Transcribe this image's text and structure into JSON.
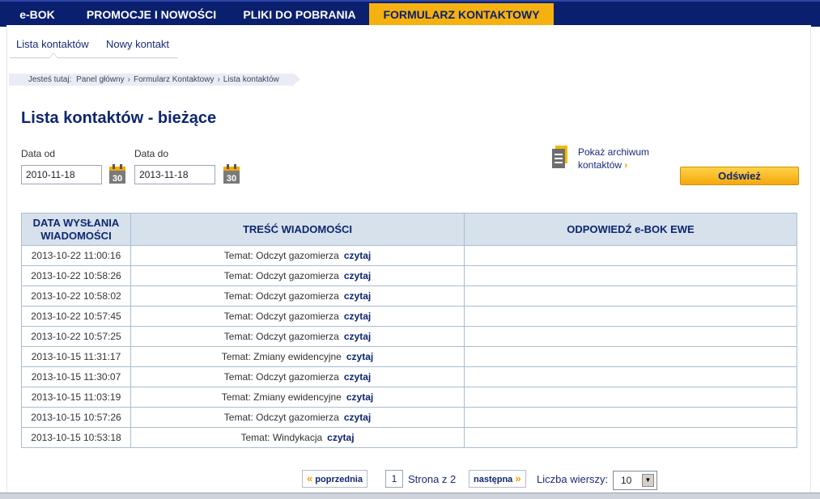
{
  "topnav": {
    "items": [
      {
        "label": "e-BOK"
      },
      {
        "label": "PROMOCJE I NOWOŚCI"
      },
      {
        "label": "PLIKI DO POBRANIA"
      },
      {
        "label": "FORMULARZ KONTAKTOWY",
        "active": true
      }
    ]
  },
  "subtabs": {
    "list": "Lista kontaktów",
    "new": "Nowy kontakt"
  },
  "breadcrumb": {
    "prefix": "Jesteś tutaj:",
    "items": [
      "Panel główny",
      "Formularz Kontaktowy",
      "Lista kontaktów"
    ]
  },
  "page_title": "Lista kontaktów - bieżące",
  "filters": {
    "date_from_label": "Data od",
    "date_from_value": "2010-11-18",
    "date_to_label": "Data do",
    "date_to_value": "2013-11-18",
    "calendar_day": "30"
  },
  "archive": {
    "line1": "Pokaż archiwum",
    "line2": "kontaktów",
    "chevron": "›"
  },
  "refresh_label": "Odśwież",
  "table": {
    "headers": [
      "DATA WYSŁANIA WIADOMOŚCI",
      "TREŚĆ WIADOMOŚCI",
      "ODPOWIEDŹ e-BOK EWE"
    ],
    "read_label": "czytaj",
    "rows": [
      {
        "date": "2013-10-22 11:00:16",
        "subject": "Temat: Odczyt gazomierza",
        "reply": ""
      },
      {
        "date": "2013-10-22 10:58:26",
        "subject": "Temat: Odczyt gazomierza",
        "reply": ""
      },
      {
        "date": "2013-10-22 10:58:02",
        "subject": "Temat: Odczyt gazomierza",
        "reply": ""
      },
      {
        "date": "2013-10-22 10:57:45",
        "subject": "Temat: Odczyt gazomierza",
        "reply": ""
      },
      {
        "date": "2013-10-22 10:57:25",
        "subject": "Temat: Odczyt gazomierza",
        "reply": ""
      },
      {
        "date": "2013-10-15 11:31:17",
        "subject": "Temat: Zmiany ewidencyjne",
        "reply": ""
      },
      {
        "date": "2013-10-15 11:30:07",
        "subject": "Temat: Odczyt gazomierza",
        "reply": ""
      },
      {
        "date": "2013-10-15 11:03:19",
        "subject": "Temat: Zmiany ewidencyjne",
        "reply": ""
      },
      {
        "date": "2013-10-15 10:57:26",
        "subject": "Temat: Odczyt gazomierza",
        "reply": ""
      },
      {
        "date": "2013-10-15 10:53:18",
        "subject": "Temat: Windykacja",
        "reply": ""
      }
    ]
  },
  "pager": {
    "prev_label": "poprzednia",
    "current_page": "1",
    "of_label": "Strona z 2",
    "next_label": "następna",
    "rows_label": "Liczba wierszy:",
    "rows_value": "10"
  },
  "colors": {
    "nav_bg": "#0a1f6e",
    "accent": "#f5b10f",
    "header_bg": "#d7e1ec",
    "title": "#0d2670"
  }
}
